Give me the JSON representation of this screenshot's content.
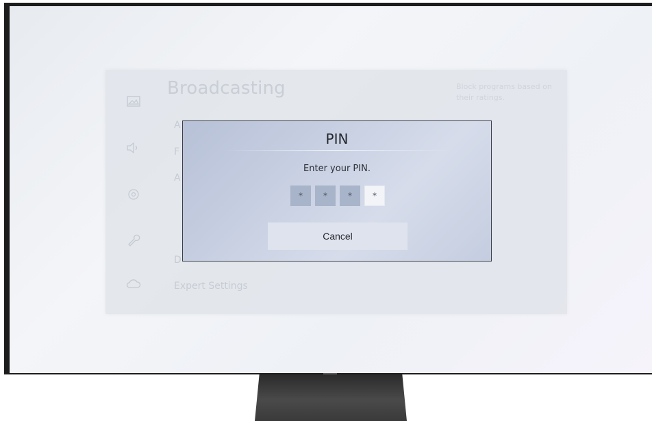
{
  "background_menu": {
    "title": "Broadcasting",
    "items": [
      {
        "label": "A"
      },
      {
        "label": "F"
      },
      {
        "label": "A"
      },
      {
        "label": "D"
      },
      {
        "label": "Expert Settings"
      }
    ],
    "help_text": "Block programs based on their ratings.",
    "sidebar_icons": [
      "picture-icon",
      "sound-icon",
      "broadcast-icon",
      "support-wrench-icon",
      "cloud-icon"
    ]
  },
  "pin_dialog": {
    "title": "PIN",
    "instruction": "Enter your PIN.",
    "pin_digits": [
      "*",
      "*",
      "*",
      "*"
    ],
    "active_digit_index": 3,
    "cancel_label": "Cancel"
  },
  "colors": {
    "dialog_bg": "#c9d1e3",
    "cancel_bg": "#dfe3ee",
    "pin_box": "#a8b4c9",
    "pin_box_active": "#f2f4f8"
  }
}
